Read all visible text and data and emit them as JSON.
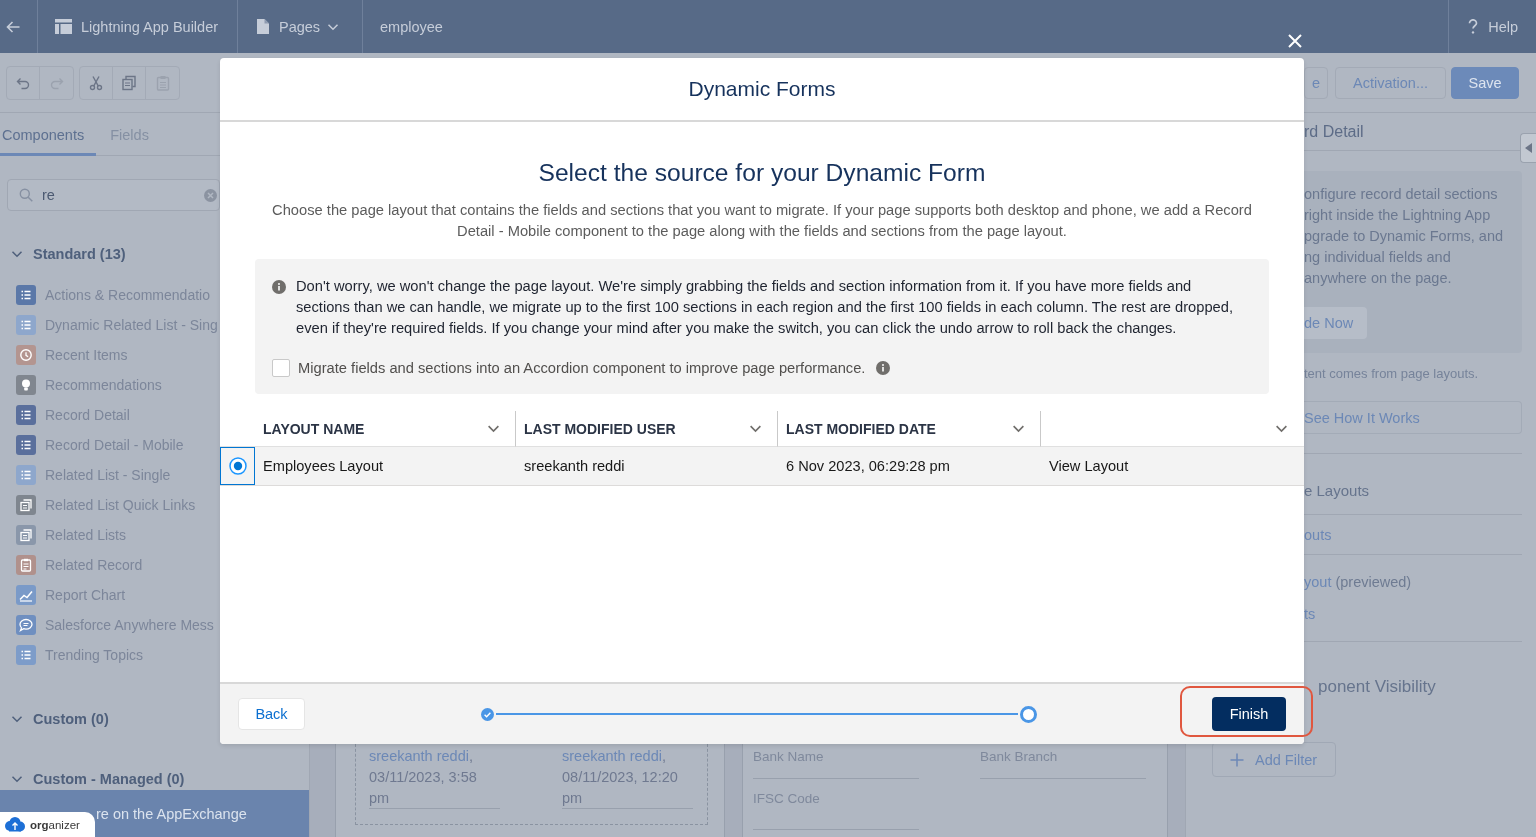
{
  "top_bar": {
    "app_name": "Lightning App Builder",
    "pages_menu": "Pages",
    "page_name": "employee",
    "help": "Help"
  },
  "toolbar": {
    "edit_buttons": [
      {
        "disabled": false
      },
      {
        "disabled": true
      },
      {
        "disabled": false
      },
      {
        "disabled": false
      },
      {
        "disabled": true
      }
    ],
    "buttons": [
      {
        "label": "e",
        "kind": "neutral"
      },
      {
        "label": "Activation...",
        "kind": "neutral"
      },
      {
        "label": "Save",
        "kind": "brand"
      }
    ]
  },
  "sidebar": {
    "tabs": [
      {
        "label": "Components",
        "selected": true
      },
      {
        "label": "Fields",
        "selected": false
      }
    ],
    "search": {
      "value": "re"
    },
    "sections": [
      {
        "title": "Standard (13)",
        "expanded": true,
        "items": [
          {
            "label": "Actions & Recommendatio",
            "color": "#5b78a8"
          },
          {
            "label": "Dynamic Related List - Sing",
            "color": "#8ea7cc"
          },
          {
            "label": "Recent Items",
            "color": "#b39590"
          },
          {
            "label": "Recommendations",
            "color": "#80868f"
          },
          {
            "label": "Record Detail",
            "color": "#5a6f9c"
          },
          {
            "label": "Record Detail - Mobile",
            "color": "#5a6f9c"
          },
          {
            "label": "Related List - Single",
            "color": "#8ea7cc"
          },
          {
            "label": "Related List Quick Links",
            "color": "#7f868f"
          },
          {
            "label": "Related Lists",
            "color": "#8a97aa"
          },
          {
            "label": "Related Record",
            "color": "#b0918c"
          },
          {
            "label": "Report Chart",
            "color": "#7a9ac8"
          },
          {
            "label": "Salesforce Anywhere Mess",
            "color": "#6f8fc0"
          },
          {
            "label": "Trending Topics",
            "color": "#7d9cc9"
          }
        ]
      },
      {
        "title": "Custom (0)",
        "expanded": true
      },
      {
        "title": "Custom - Managed (0)",
        "expanded": true
      }
    ],
    "appexchange_link": "re on the AppExchange"
  },
  "organizer_badge": {
    "label": "**org**anizer"
  },
  "canvas": {
    "system_info_card": {
      "fields": [
        {
          "user": "sreekanth reddi",
          "text": ", 03/11/2023, 3:58 pm"
        },
        {
          "user": "sreekanth reddi",
          "text": ", 08/11/2023, 12:20 pm"
        }
      ]
    },
    "detail_card": {
      "fields": [
        "Bank Name",
        "Bank Branch",
        "IFSC Code"
      ]
    }
  },
  "properties_panel": {
    "title": "rd Detail",
    "upgrade_box": {
      "lines": [
        "onfigure record detail sections",
        "right inside the Lightning App",
        "pgrade to Dynamic Forms, and",
        "ng individual fields and",
        "anywhere on the page."
      ],
      "button": "de Now"
    },
    "note": "tent comes from page layouts.",
    "how_button": "See How It Works",
    "layouts_heading": "e Layouts",
    "layout_links": [
      {
        "link": "outs"
      },
      {
        "link": "yout",
        "note": "(previewed)"
      },
      {
        "link": "ts"
      }
    ],
    "visibility_heading": "ponent Visibility",
    "add_filter": "Add Filter"
  },
  "modal": {
    "title": "Dynamic Forms",
    "heading": "Select the source for your Dynamic Form",
    "description": "Choose the page layout that contains the fields and sections that you want to migrate. If your page supports both desktop and phone, we add a Record Detail - Mobile component to the page along with the fields and sections from the page layout.",
    "info": "Don't worry, we won't change the page layout. We're simply grabbing the fields and section information from it. If you have more fields and sections than we can handle, we migrate up to the first 100 sections in each region and the first 100 fields in each column. The rest are dropped, even if they're required fields. If you change your mind after you make the switch, you can click the undo arrow to roll back the changes.",
    "accordion_option": {
      "label": "Migrate fields and sections into an Accordion component to improve page performance.",
      "checked": false
    },
    "table": {
      "columns": [
        {
          "kind": "sortable",
          "label": "LAYOUT NAME"
        },
        {
          "kind": "sortable",
          "label": "LAST MODIFIED USER"
        },
        {
          "kind": "sortable",
          "label": "LAST MODIFIED DATE"
        },
        {
          "kind": "menu"
        }
      ],
      "rows": [
        {
          "selected": true,
          "cells": [
            "Employees Layout",
            "sreekanth reddi",
            "6 Nov 2023, 06:29:28 pm",
            "View Layout"
          ]
        }
      ]
    },
    "footer": {
      "back": "Back",
      "progress": {
        "level": 1,
        "steps": [
          {
            "completed": true,
            "selected": false
          },
          {
            "completed": false,
            "selected": true
          }
        ]
      },
      "finish": {
        "label": "Finish",
        "highlighted": true
      }
    }
  }
}
